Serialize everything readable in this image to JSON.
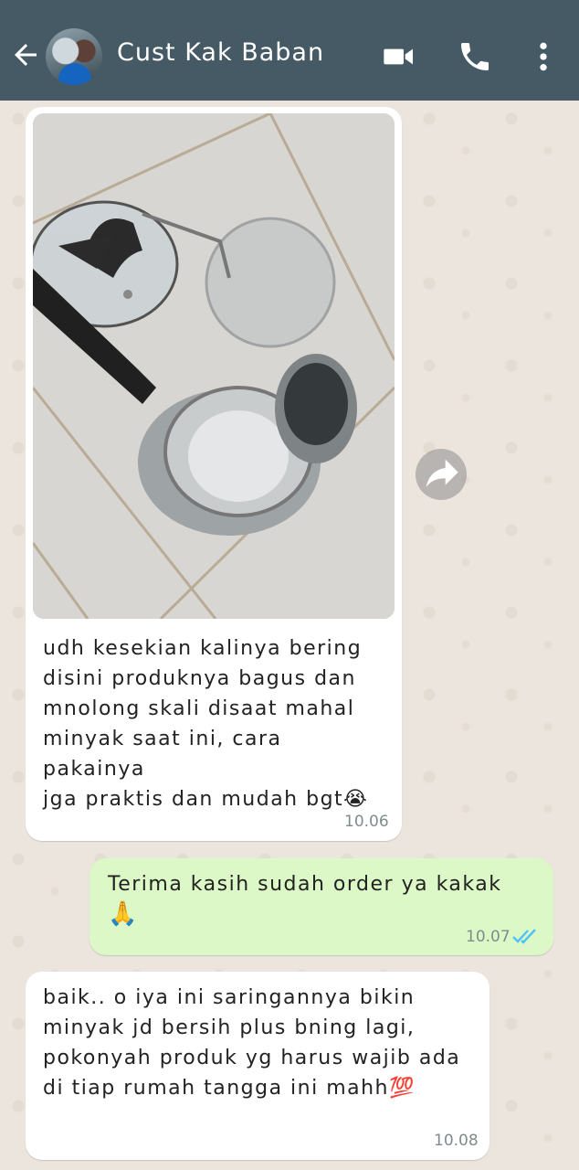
{
  "header": {
    "contact_name": "Cust Kak Baban"
  },
  "messages": [
    {
      "direction": "incoming",
      "has_image": true,
      "text": "udh kesekian kalinya bering disini produknya bagus dan mnolong skali disaat mahal minyak saat ini, cara pakainya jga praktis dan mudah bgt😭",
      "lines": [
        "udh kesekian kalinya bering",
        "disini produknya bagus dan",
        "mnolong skali disaat mahal",
        "minyak saat ini, cara pakainya",
        "jga praktis dan mudah bgt😭"
      ],
      "time": "10.06"
    },
    {
      "direction": "outgoing",
      "lines": [
        "Terima kasih sudah order ya kakak",
        "🙏"
      ],
      "time": "10.07",
      "status": "read"
    },
    {
      "direction": "incoming",
      "lines": [
        "baik.. o iya ini saringannya bikin",
        "minyak jd bersih plus bning lagi,",
        "pokonyah produk yg harus wajib ada",
        "di tiap rumah tangga ini mahh💯"
      ],
      "time": "10.08"
    }
  ],
  "icons": {
    "back": "arrow-left-icon",
    "video": "video-camera-icon",
    "call": "phone-icon",
    "menu": "more-vertical-icon",
    "forward": "share-forward-icon",
    "read_receipt": "double-check-icon"
  },
  "colors": {
    "header_bg": "#455a64",
    "chat_bg": "#ece5dd",
    "incoming_bubble": "#ffffff",
    "outgoing_bubble": "#dcf8c6",
    "read_tick": "#4fc3f7"
  }
}
